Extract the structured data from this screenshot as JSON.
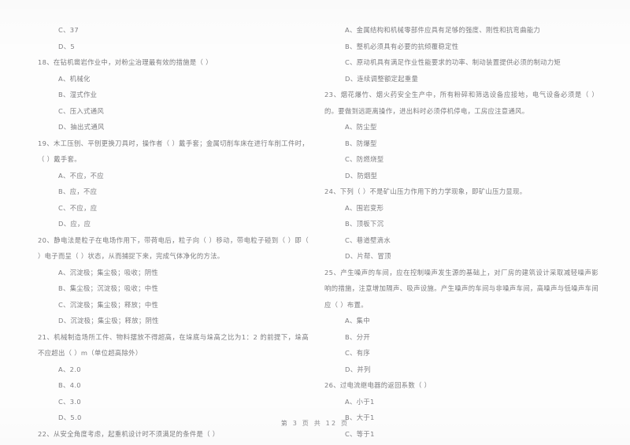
{
  "document": {
    "type": "scanned-exam-paper",
    "page_footer": "第 3 页 共 12 页",
    "ink_color": "#6f6f72",
    "paper_color": "#fdfdfd"
  },
  "left_column": {
    "items": [
      {
        "kind": "option",
        "text": "C、37"
      },
      {
        "kind": "option",
        "text": "D、5"
      },
      {
        "kind": "stem",
        "text": "18、在钻机凿岩作业中，对粉尘治理最有效的措施是（      ）"
      },
      {
        "kind": "option",
        "text": "A、机械化"
      },
      {
        "kind": "option",
        "text": "B、湿式作业"
      },
      {
        "kind": "option",
        "text": "C、压入式通风"
      },
      {
        "kind": "option",
        "text": "D、抽出式通风"
      },
      {
        "kind": "stem",
        "text": "19、木工压刨、平刨更换刀具时，操作者（      ）戴手套；金属切削车床在进行车削工件时，（      ）戴手套。"
      },
      {
        "kind": "option",
        "text": "A、不应，不应"
      },
      {
        "kind": "option",
        "text": "B、应，不应"
      },
      {
        "kind": "option",
        "text": "C、不应，应"
      },
      {
        "kind": "option",
        "text": "D、应，应"
      },
      {
        "kind": "stem",
        "text": "20、静电法是粒子在电场作用下，带荷电后，粒子向（      ）移动，带电粒子碰到（      ）即（      ）电子而呈（      ）状态，从而捕捉下来，完成气体净化的方法。"
      },
      {
        "kind": "option",
        "text": "A、沉淀极；集尘极；吸收；阴性"
      },
      {
        "kind": "option",
        "text": "B、集尘极；沉淀极；吸收；中性"
      },
      {
        "kind": "option",
        "text": "C、沉淀极；集尘极；释放；中性"
      },
      {
        "kind": "option",
        "text": "D、沉淀极；集尘极；释放；阴性"
      },
      {
        "kind": "stem",
        "text": "21、机械制造场所工件、物料摆放不得超高，在垛底与垛高之比为1：2 的前提下，垛高不应超出（      ）m（单位超高除外）"
      },
      {
        "kind": "option",
        "text": "A、2.0"
      },
      {
        "kind": "option",
        "text": "B、4.0"
      },
      {
        "kind": "option",
        "text": "C、3.0"
      },
      {
        "kind": "option",
        "text": "D、5.0"
      },
      {
        "kind": "stem",
        "text": "22、从安全角度考虑，起重机设计时不须满足的条件是（      ）"
      }
    ]
  },
  "right_column": {
    "items": [
      {
        "kind": "option",
        "text": "A、金属结构和机械零部件应具有足够的强度、刚性和抗弯曲能力"
      },
      {
        "kind": "option",
        "text": "B、整机必须具有必要的抗倾覆稳定性"
      },
      {
        "kind": "option",
        "text": "C、原动机具有满足作业性能要求的功率、制动装置提供必须的制动力矩"
      },
      {
        "kind": "option",
        "text": "D、连续调整额定起重量"
      },
      {
        "kind": "stem",
        "text": "23、烟花爆竹、烟火药安全生产中，所有粉碎和筛选设备应接地，电气设备必须是（      ）的。要做到远距离操作，进出料时必须停机停电，工房应注意通风。"
      },
      {
        "kind": "option",
        "text": "A、防尘型"
      },
      {
        "kind": "option",
        "text": "B、防爆型"
      },
      {
        "kind": "option",
        "text": "C、防燃烧型"
      },
      {
        "kind": "option",
        "text": "D、防烟型"
      },
      {
        "kind": "stem",
        "text": "24、下列（      ）不是矿山压力作用下的力学现象，即矿山压力显现。"
      },
      {
        "kind": "option",
        "text": "A、围岩变形"
      },
      {
        "kind": "option",
        "text": "B、顶板下沉"
      },
      {
        "kind": "option",
        "text": "C、巷道壁滴水"
      },
      {
        "kind": "option",
        "text": "D、片帮、冒顶"
      },
      {
        "kind": "stem",
        "text": "25、产生噪声的车间，应在控制噪声发生源的基础上，对厂房的建筑设计采取减轻噪声影响的措施，注意增加隔声、吸声设施。产生噪声的车间与非噪声车间，高噪声与低噪声车间应（      ）布置。"
      },
      {
        "kind": "option",
        "text": "A、集中"
      },
      {
        "kind": "option",
        "text": "B、分开"
      },
      {
        "kind": "option",
        "text": "C、有序"
      },
      {
        "kind": "option",
        "text": "D、并列"
      },
      {
        "kind": "stem",
        "text": "26、过电流继电器的返回系数（      ）"
      },
      {
        "kind": "option",
        "text": "A、小于1"
      },
      {
        "kind": "option",
        "text": "B、大于1"
      },
      {
        "kind": "option",
        "text": "C、等于1"
      }
    ]
  }
}
